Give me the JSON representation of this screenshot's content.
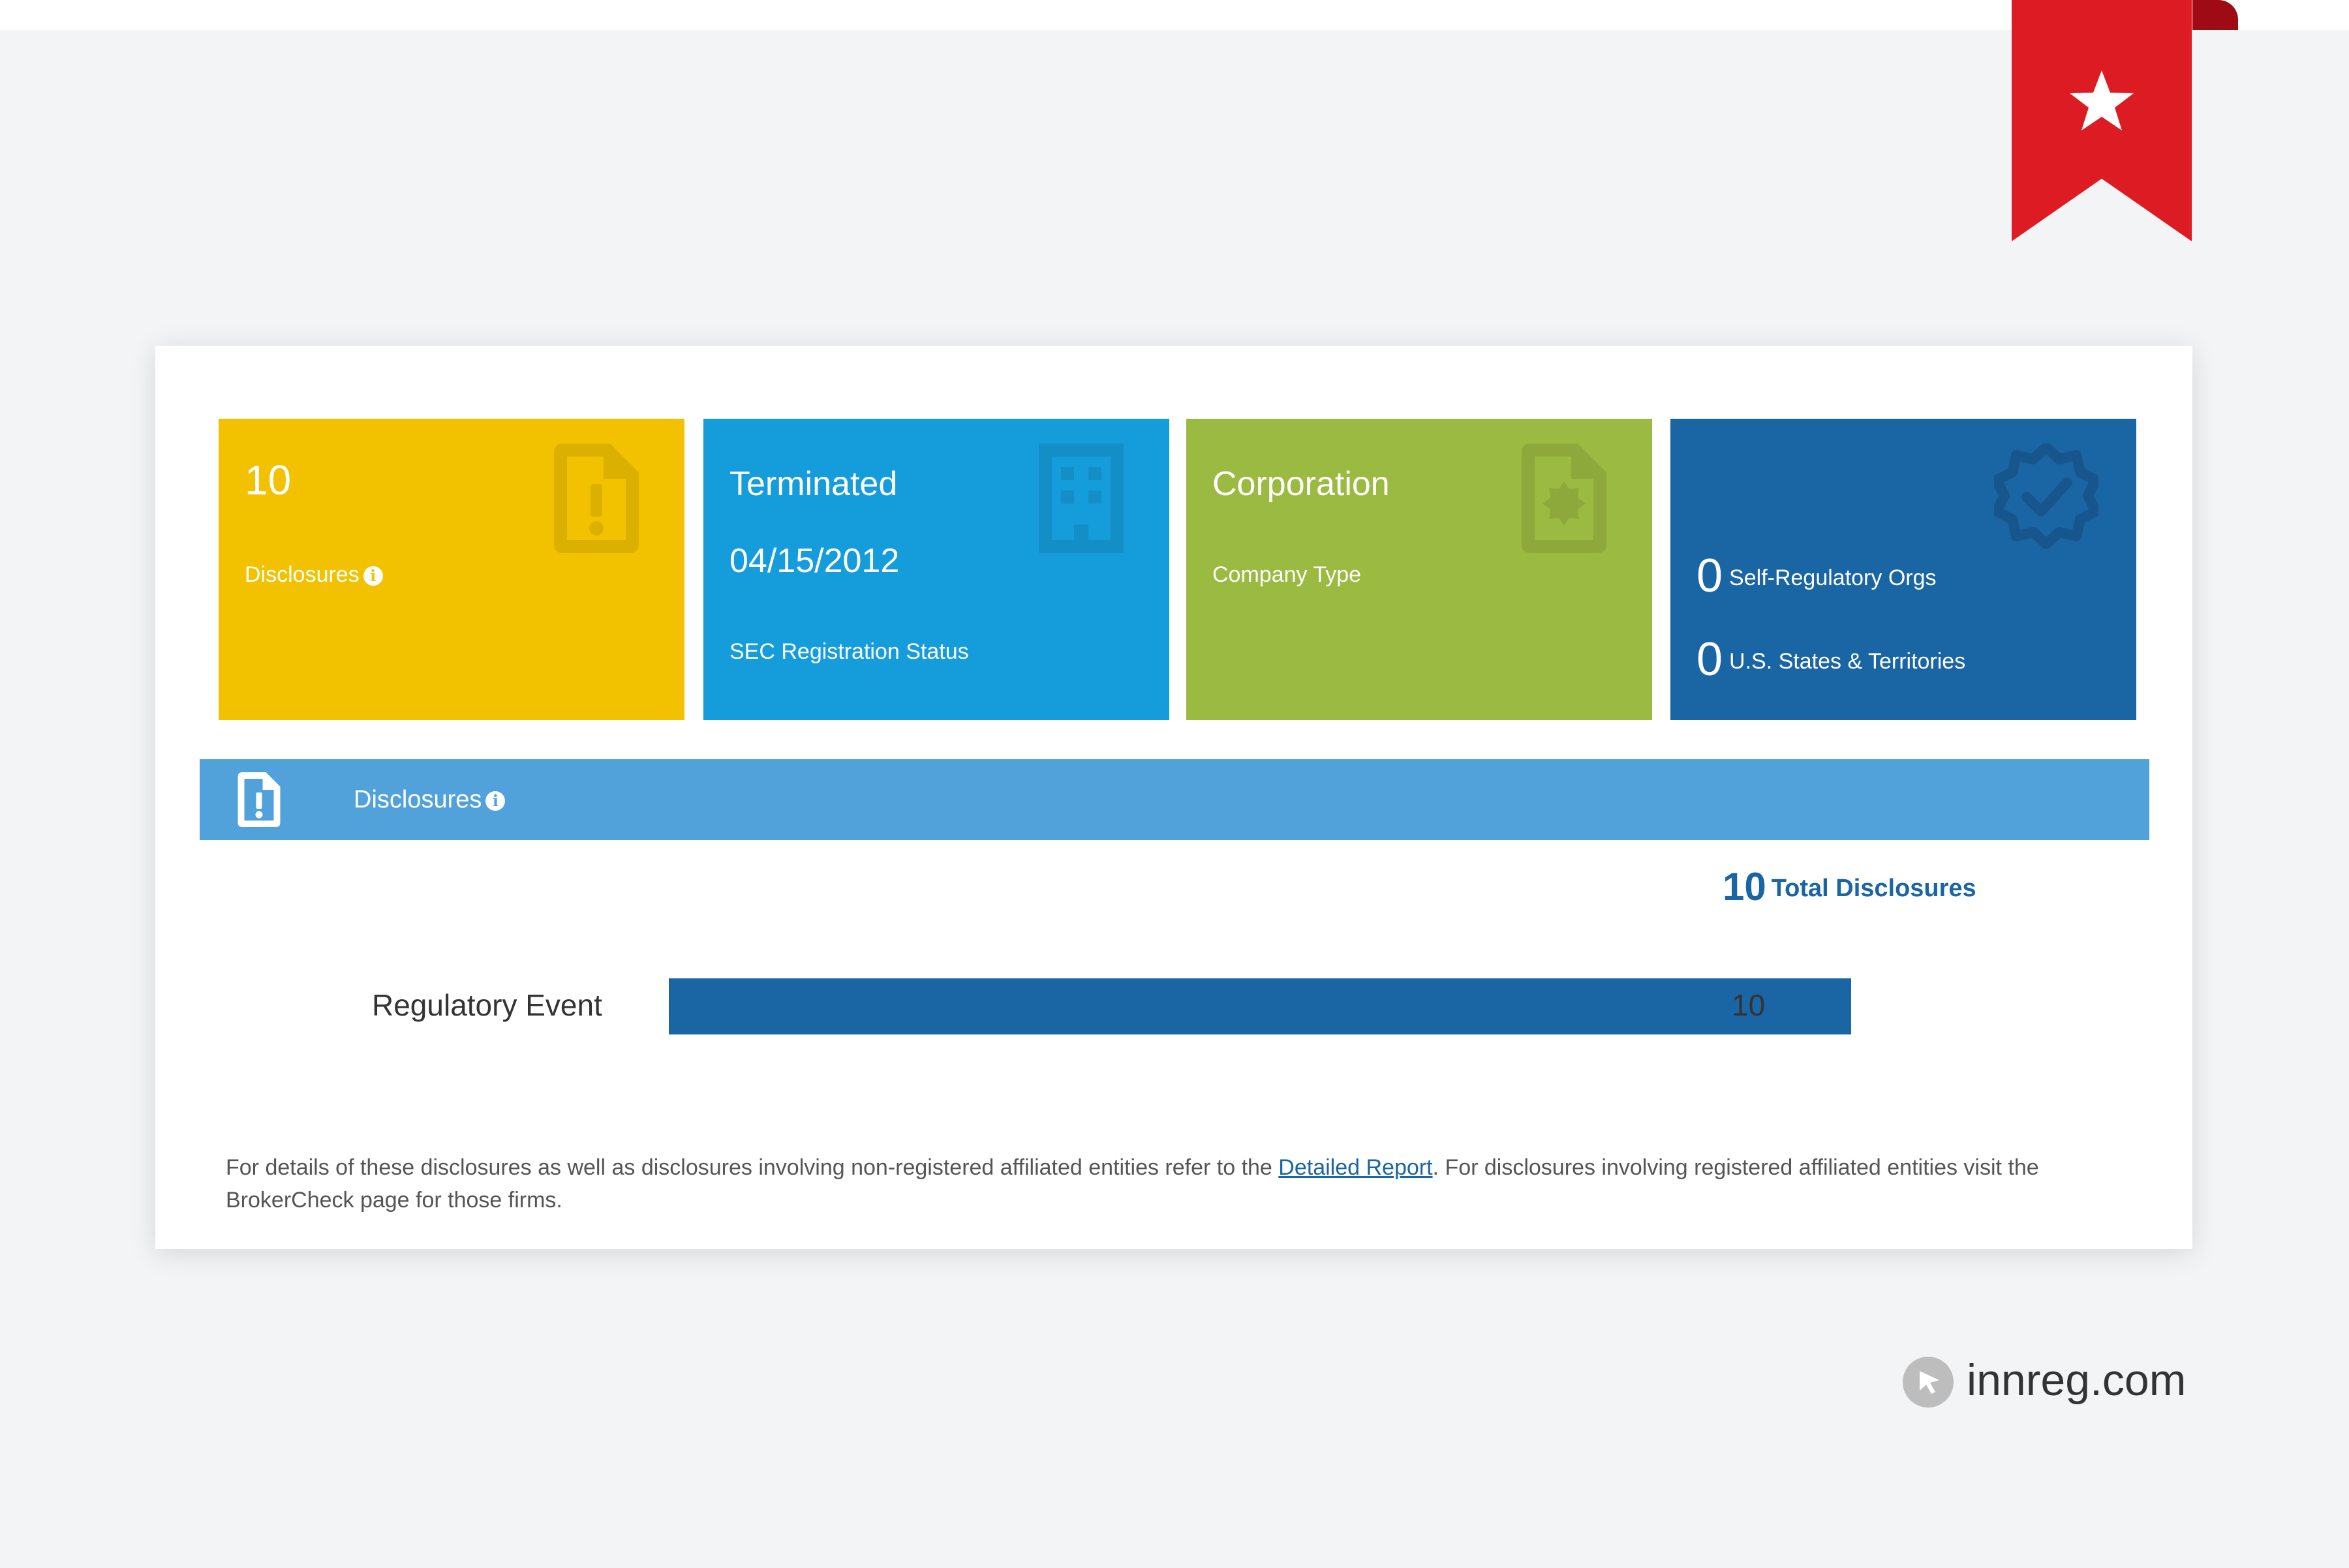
{
  "tiles": {
    "disclosures": {
      "count": "10",
      "label": "Disclosures"
    },
    "registration": {
      "status": "Terminated",
      "date": "04/15/2012",
      "label": "SEC Registration Status"
    },
    "company": {
      "type": "Corporation",
      "label": "Company Type"
    },
    "registrations": {
      "sro_count": "0",
      "sro_label": "Self-Regulatory Orgs",
      "states_count": "0",
      "states_label": "U.S. States & Territories"
    }
  },
  "disclosures_section": {
    "title": "Disclosures",
    "total_count": "10",
    "total_label": "Total Disclosures"
  },
  "chart_data": {
    "type": "bar",
    "orientation": "horizontal",
    "categories": [
      "Regulatory Event"
    ],
    "values": [
      10
    ],
    "xlim": [
      0,
      10
    ]
  },
  "footnote": {
    "before_link": "For details of these disclosures as well as disclosures involving non-registered affiliated entities refer to the ",
    "link_text": "Detailed Report",
    "after_link": ". For disclosures involving registered affiliated entities visit the BrokerCheck page for those firms."
  },
  "brand": {
    "text": "innreg.com"
  },
  "colors": {
    "yellow": "#f2c200",
    "sky": "#159ddb",
    "green": "#9bba41",
    "navy": "#1a65a3",
    "bar_light": "#51a2da",
    "ribbon": "#dc1c22"
  }
}
